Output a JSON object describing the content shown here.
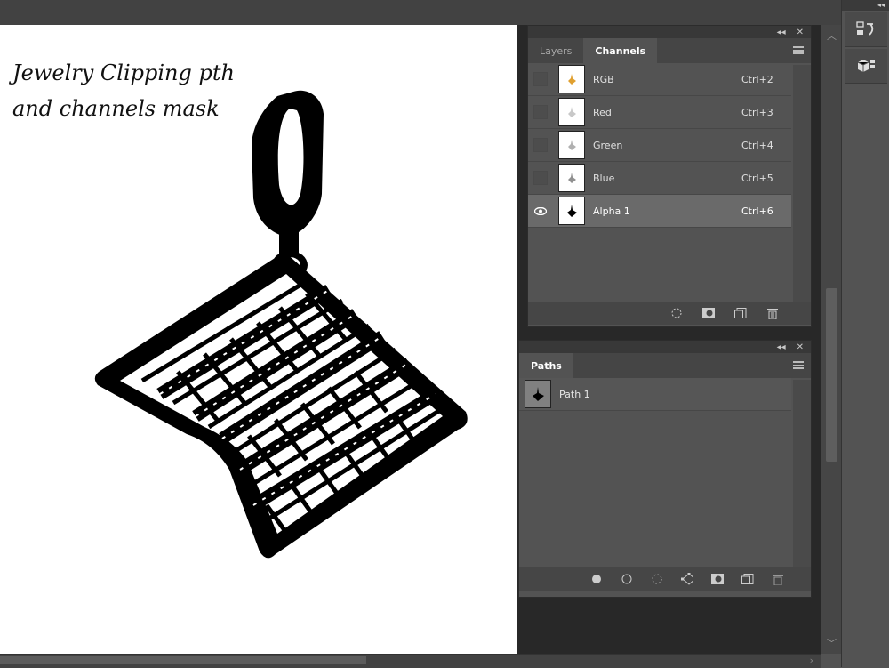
{
  "canvas": {
    "overlay_line1": "Jewelry Clipping pth",
    "overlay_line2": "and channels mask"
  },
  "channels_panel": {
    "tabs": [
      {
        "label": "Layers",
        "active": false
      },
      {
        "label": "Channels",
        "active": true
      }
    ],
    "rows": [
      {
        "name": "RGB",
        "shortcut": "Ctrl+2",
        "visible": false,
        "selected": false
      },
      {
        "name": "Red",
        "shortcut": "Ctrl+3",
        "visible": false,
        "selected": false
      },
      {
        "name": "Green",
        "shortcut": "Ctrl+4",
        "visible": false,
        "selected": false
      },
      {
        "name": "Blue",
        "shortcut": "Ctrl+5",
        "visible": false,
        "selected": false
      },
      {
        "name": "Alpha 1",
        "shortcut": "Ctrl+6",
        "visible": true,
        "selected": true
      }
    ],
    "footer_icons": [
      "load-selection-icon",
      "save-selection-icon",
      "new-channel-icon",
      "trash-icon"
    ]
  },
  "paths_panel": {
    "tabs": [
      {
        "label": "Paths",
        "active": true
      }
    ],
    "rows": [
      {
        "name": "Path 1"
      }
    ],
    "footer_icons": [
      "fill-path-icon",
      "stroke-path-icon",
      "load-path-selection-icon",
      "make-work-path-icon",
      "add-mask-icon",
      "new-path-icon",
      "trash-icon"
    ]
  },
  "right_dock": {
    "buttons": [
      "history-icon",
      "3d-icon"
    ]
  },
  "colors": {
    "ui_bg": "#535353",
    "selected_row": "#6a6a6a",
    "document_bg": "#ffffff"
  }
}
